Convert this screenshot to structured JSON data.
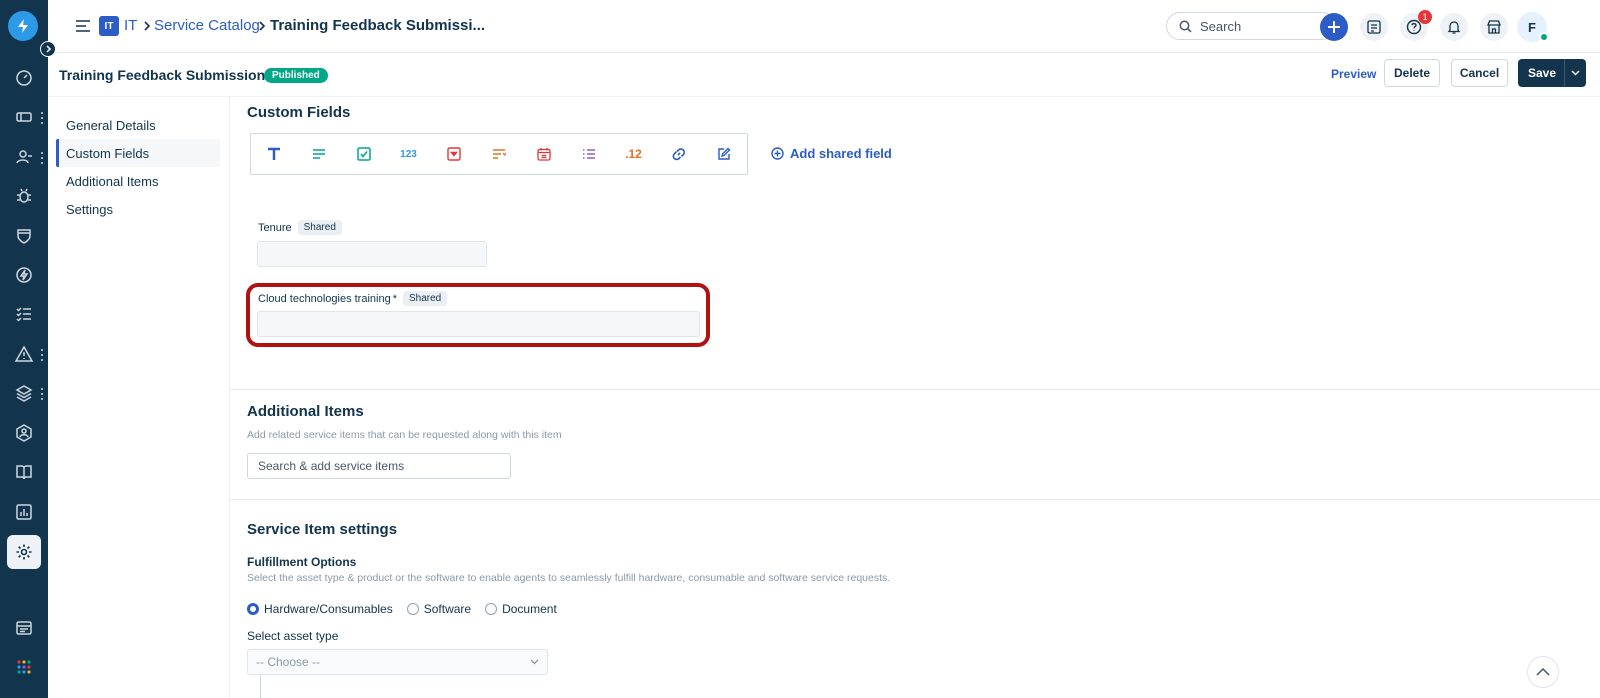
{
  "breadcrumb": {
    "workspace_badge": "IT",
    "workspace": "IT",
    "catalog": "Service Catalog",
    "current": "Training Feedback Submissi..."
  },
  "header": {
    "search_placeholder": "Search",
    "help_count": "1",
    "avatar_initial": "F"
  },
  "item": {
    "title": "Training Feedback Submission",
    "status": "Published"
  },
  "actions": {
    "preview": "Preview",
    "delete": "Delete",
    "cancel": "Cancel",
    "save": "Save"
  },
  "nav": {
    "items": [
      {
        "label": "General Details"
      },
      {
        "label": "Custom Fields",
        "active": true
      },
      {
        "label": "Additional Items"
      },
      {
        "label": "Settings"
      }
    ]
  },
  "custom_fields": {
    "title": "Custom Fields",
    "toolbar": {
      "number_label": "123",
      "decimal_label": ".12"
    },
    "add_shared": "Add shared field",
    "fields": [
      {
        "label": "Tenure",
        "required": "",
        "tag": "Shared"
      },
      {
        "label": "Cloud technologies training",
        "required": "*",
        "tag": "Shared"
      }
    ]
  },
  "additional_items": {
    "title": "Additional Items",
    "help": "Add related service items that can be requested along with this item",
    "search_placeholder": "Search & add service items"
  },
  "settings": {
    "title": "Service Item settings",
    "fulfillment_title": "Fulfillment Options",
    "fulfillment_help": "Select the asset type & product or the software to enable agents to seamlessly fulfill hardware, consumable and software service requests.",
    "options": [
      "Hardware/Consumables",
      "Software",
      "Document"
    ],
    "selected_option": "Hardware/Consumables",
    "asset_type_label": "Select asset type",
    "asset_type_value": "-- Choose --"
  },
  "colors": {
    "brand_dark": "#12344d",
    "link_blue": "#2c5cc5",
    "published_green": "#00a886",
    "highlight_red": "#b11111"
  }
}
